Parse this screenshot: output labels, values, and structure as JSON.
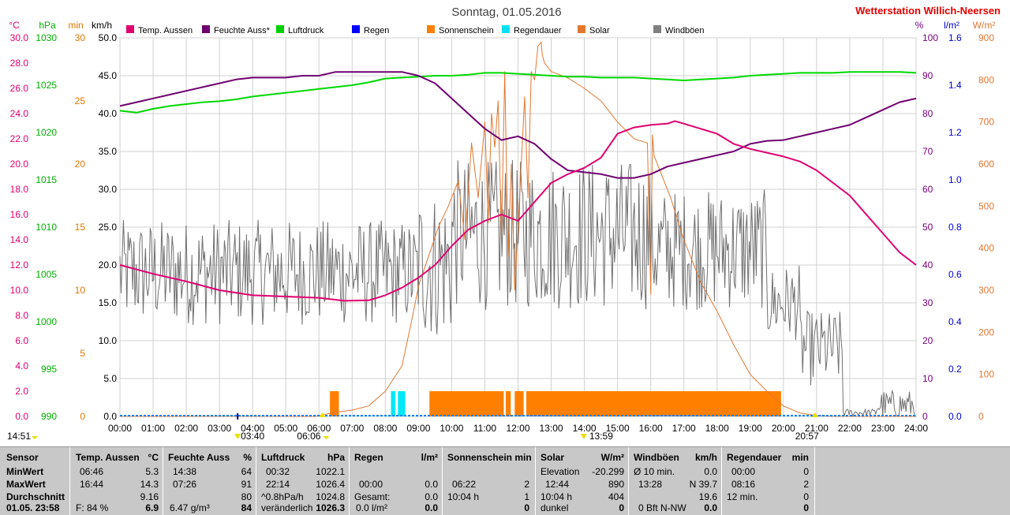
{
  "chart_data": {
    "type": "line",
    "title": "Sonntag, 01.05.2016",
    "station": "Wetterstation Willich-Neersen",
    "x_ticks": [
      "00:00",
      "01:00",
      "02:00",
      "03:00",
      "04:00",
      "05:00",
      "06:00",
      "07:00",
      "08:00",
      "09:00",
      "10:00",
      "11:00",
      "12:00",
      "13:00",
      "14:00",
      "15:00",
      "16:00",
      "17:00",
      "18:00",
      "19:00",
      "20:00",
      "21:00",
      "22:00",
      "23:00",
      "24:00"
    ],
    "axes": {
      "temp_c": {
        "unit": "°C",
        "range": [
          0,
          30
        ],
        "ticks": [
          "0.0",
          "2.0",
          "4.0",
          "6.0",
          "8.0",
          "10.0",
          "12.0",
          "14.0",
          "16.0",
          "18.0",
          "20.0",
          "22.0",
          "24.0",
          "26.0",
          "28.0",
          "30.0"
        ],
        "color": "#e0006e"
      },
      "pressure_hpa": {
        "unit": "hPa",
        "range": [
          990,
          1030
        ],
        "ticks": [
          "990",
          "995",
          "1000",
          "1005",
          "1010",
          "1015",
          "1020",
          "1025",
          "1030"
        ],
        "color": "#00b000"
      },
      "sunshine_min": {
        "unit": "min",
        "range": [
          0,
          30
        ],
        "ticks": [
          "0",
          "5",
          "10",
          "15",
          "20",
          "25",
          "30"
        ],
        "color": "#e07800"
      },
      "wind_kmh": {
        "unit": "km/h",
        "range": [
          0,
          50
        ],
        "ticks": [
          "0.0",
          "5.0",
          "10.0",
          "15.0",
          "20.0",
          "25.0",
          "30.0",
          "35.0",
          "40.0",
          "45.0",
          "50.0"
        ],
        "color": "#000000"
      },
      "humidity_pct": {
        "unit": "%",
        "range": [
          0,
          100
        ],
        "ticks": [
          "0",
          "10",
          "20",
          "30",
          "40",
          "50",
          "60",
          "70",
          "80",
          "90",
          "100"
        ],
        "color": "#7a0080"
      },
      "rain_lm2": {
        "unit": "l/m²",
        "range": [
          0,
          1.6
        ],
        "ticks": [
          "0.0",
          "0.2",
          "0.4",
          "0.6",
          "0.8",
          "1.0",
          "1.2",
          "1.4",
          "1.6"
        ],
        "color": "#0000d0"
      },
      "solar_wm2": {
        "unit": "W/m²",
        "range": [
          0,
          900
        ],
        "ticks": [
          "0",
          "100",
          "200",
          "300",
          "400",
          "500",
          "600",
          "700",
          "800",
          "900"
        ],
        "color": "#e07830"
      }
    },
    "legend": [
      {
        "name": "Temp. Aussen",
        "color": "#e0006e"
      },
      {
        "name": "Feuchte Auss*",
        "color": "#700070"
      },
      {
        "name": "Luftdruck",
        "color": "#00d000"
      },
      {
        "name": "Regen",
        "color": "#0000ff"
      },
      {
        "name": "Sonnenschein",
        "color": "#ff8000"
      },
      {
        "name": "Regendauer",
        "color": "#00e0f0"
      },
      {
        "name": "Solar",
        "color": "#e07830"
      },
      {
        "name": "Windböen",
        "color": "#808080"
      }
    ],
    "series": [
      {
        "name": "Temp. Aussen",
        "axis": "temp_c",
        "x": [
          0,
          1,
          2,
          3,
          4,
          5,
          6,
          6.77,
          7.5,
          8,
          8.5,
          9,
          9.5,
          10,
          10.5,
          11,
          11.5,
          12,
          12.5,
          13,
          13.5,
          14,
          14.5,
          15,
          15.5,
          16,
          16.5,
          16.73,
          17,
          17.5,
          18,
          18.5,
          19,
          19.5,
          20,
          20.5,
          21,
          21.5,
          22,
          22.5,
          23,
          23.5,
          24
        ],
        "y": [
          12,
          11.3,
          10.7,
          10,
          9.6,
          9.5,
          9.4,
          9.16,
          9.2,
          9.6,
          10.2,
          11,
          12,
          13.5,
          14.8,
          15.5,
          16,
          15.5,
          17,
          18.5,
          19.2,
          19.7,
          20.5,
          22.4,
          22.9,
          23.1,
          23.2,
          23.4,
          23.2,
          22.8,
          22.4,
          21.6,
          21.2,
          20.9,
          20.6,
          20.2,
          19.5,
          18.5,
          17.5,
          16,
          14.5,
          13,
          12
        ]
      },
      {
        "name": "Feuchte Auss*",
        "axis": "humidity_pct",
        "x": [
          0,
          0.5,
          1,
          1.5,
          2,
          2.5,
          3,
          3.5,
          4,
          4.5,
          5,
          5.5,
          6,
          6.5,
          7,
          7.43,
          7.5,
          8,
          8.5,
          9,
          9.5,
          10,
          10.5,
          11,
          11.5,
          12,
          12.5,
          13,
          13.5,
          14,
          14.5,
          15,
          15.5,
          16,
          16.5,
          17,
          17.5,
          18,
          18.5,
          19,
          19.5,
          20,
          20.5,
          21,
          21.5,
          22,
          22.5,
          23,
          23.5,
          24
        ],
        "y": [
          82,
          83,
          84,
          85,
          86,
          87,
          88,
          89,
          89.5,
          89.5,
          89.5,
          90,
          90,
          91,
          91,
          91,
          91,
          91,
          91,
          90,
          88,
          84,
          80,
          76,
          73,
          74,
          72,
          68,
          65,
          64.5,
          64,
          63,
          63,
          64,
          66,
          67,
          68,
          69,
          70,
          72,
          72.8,
          73,
          74,
          75,
          76,
          77,
          79,
          81,
          83,
          84
        ]
      },
      {
        "name": "Luftdruck",
        "axis": "pressure_hpa",
        "x": [
          0,
          0.5,
          1,
          1.5,
          2,
          2.5,
          3,
          3.5,
          4,
          4.5,
          5,
          5.5,
          6,
          6.5,
          7,
          7.5,
          8,
          8.5,
          9,
          9.5,
          10,
          10.5,
          11,
          11.5,
          12,
          12.5,
          13,
          13.5,
          14,
          14.5,
          15,
          15.5,
          16,
          16.5,
          17,
          17.5,
          18,
          18.5,
          19,
          19.5,
          20,
          20.5,
          21,
          21.5,
          22,
          22.23,
          22.5,
          23,
          23.5,
          24
        ],
        "y": [
          1022.3,
          1022.1,
          1022.5,
          1022.8,
          1023,
          1023.2,
          1023.3,
          1023.5,
          1023.8,
          1024,
          1024.2,
          1024.4,
          1024.6,
          1024.8,
          1025,
          1025.3,
          1025.7,
          1025.8,
          1025.9,
          1026,
          1026,
          1026.1,
          1026.3,
          1026.3,
          1026.2,
          1026.1,
          1026,
          1025.9,
          1025.9,
          1025.8,
          1025.8,
          1025.8,
          1025.7,
          1025.6,
          1025.5,
          1025.6,
          1025.7,
          1025.8,
          1026,
          1026.1,
          1026.2,
          1026.3,
          1026.3,
          1026.3,
          1026.4,
          1026.4,
          1026.4,
          1026.4,
          1026.4,
          1026.3
        ]
      },
      {
        "name": "Solar",
        "axis": "solar_wm2",
        "x": [
          0,
          5.9,
          6.2,
          6.5,
          7,
          7.5,
          8,
          8.5,
          8.8,
          9,
          9.3,
          9.6,
          9.9,
          10.2,
          10.4,
          10.6,
          10.8,
          11.0,
          11.1,
          11.2,
          11.3,
          11.4,
          11.5,
          11.6,
          11.7,
          11.8,
          11.9,
          12.0,
          12.2,
          12.3,
          12.4,
          12.5,
          12.6,
          12.7,
          12.73,
          12.8,
          12.9,
          13,
          13.5,
          14,
          14.5,
          15,
          15.5,
          15.9,
          16,
          16.05,
          16.1,
          16.3,
          16.6,
          17,
          17.5,
          18,
          18.5,
          19,
          19.5,
          20,
          20.5,
          21,
          21.4,
          24
        ],
        "y": [
          0,
          0,
          5,
          10,
          15,
          25,
          60,
          120,
          230,
          310,
          380,
          450,
          500,
          560,
          420,
          650,
          520,
          700,
          460,
          720,
          640,
          750,
          420,
          820,
          380,
          600,
          300,
          450,
          760,
          520,
          820,
          800,
          880,
          890,
          860,
          840,
          830,
          820,
          805,
          780,
          750,
          700,
          660,
          650,
          290,
          670,
          620,
          580,
          520,
          420,
          320,
          250,
          170,
          100,
          60,
          25,
          8,
          2,
          0,
          0
        ]
      },
      {
        "name": "Windböen",
        "axis": "wind_kmh",
        "type": "noisy_band",
        "note": "rapidly fluctuating gust trace, roughly 13–30 km/h during the day, peaks near 39.7 km/h, dropping below 5 km/h in the late evening"
      }
    ],
    "bars": {
      "Sonnenschein": {
        "axis": "sunshine_min",
        "value": 2,
        "intervals": [
          [
            6.33,
            6.6
          ],
          [
            9.33,
            11.57
          ],
          [
            11.63,
            11.78
          ],
          [
            11.9,
            12.17
          ],
          [
            12.25,
            19.93
          ]
        ]
      },
      "Regendauer": {
        "axis": "sunshine_min",
        "value": 2,
        "intervals": [
          [
            8.17,
            8.3
          ],
          [
            8.38,
            8.6
          ]
        ]
      }
    },
    "markers": {
      "sunrise": "06:06",
      "sunset": "20:57",
      "moonrise": "03:40",
      "moonset": "14:51",
      "solar_noon": "13:59"
    }
  },
  "stats": {
    "headers": {
      "sensor": "Sensor",
      "temp": "Temp. Aussen",
      "temp_unit": "°C",
      "hum": "Feuchte Auss",
      "hum_unit": "%",
      "press": "Luftdruck",
      "press_unit": "hPa",
      "rain": "Regen",
      "rain_unit": "l/m²",
      "sun": "Sonnenschein min",
      "solar": "Solar",
      "solar_unit": "W/m²",
      "wind": "Windböen",
      "wind_unit": "km/h",
      "raindur": "Regendauer",
      "raindur_unit": "min"
    },
    "labels": {
      "min": "MinWert",
      "max": "MaxWert",
      "avg": "Durchschnitt",
      "date": "01.05. 23:58"
    },
    "temp": {
      "min_time": "06:46",
      "min": "5.3",
      "max_time": "16:44",
      "max": "14.3",
      "avg": "9.16",
      "now_label": "F: 84 %",
      "now": "6.9"
    },
    "hum": {
      "min_time": "14:38",
      "min": "64",
      "max_time": "07:26",
      "max": "91",
      "avg": "80",
      "now_label": "6.47 g/m³",
      "now": "84"
    },
    "press": {
      "min_time": "00:32",
      "min": "1022.1",
      "max_time": "22:14",
      "max": "1026.4",
      "avg_label": "^0.8hPa/h",
      "avg": "1024.8",
      "now_label": "veränderlich",
      "now": "1026.3"
    },
    "rain": {
      "r1_time": "00:00",
      "r1": "0.0",
      "r2_label": "Gesamt:",
      "r2": "0.0",
      "now_label": "0.0 l/m²",
      "now": "0.0"
    },
    "sun": {
      "r1_time": "06:22",
      "r1": "2",
      "r2_label": "10:04 h",
      "r2": "1",
      "now": "0"
    },
    "solar": {
      "r0_label": "Elevation",
      "r0": "-20.299",
      "r1_time": "12:44",
      "r1": "890",
      "r2_label": "10:04 h",
      "r2": "404",
      "now_label": "dunkel",
      "now": "0"
    },
    "wind": {
      "r0_label": "Ø 10 min.",
      "r0": "0.0",
      "r1_time": "13:28",
      "r1": "N 39.7",
      "r2": "19.6",
      "now_label": "0 Bft N-NW",
      "now": "0.0"
    },
    "raindur": {
      "r0_time": "00:00",
      "r0": "0",
      "r1_time": "08:16",
      "r1": "2",
      "r2_label": "12 min.",
      "r2": "0",
      "now": "0"
    }
  }
}
